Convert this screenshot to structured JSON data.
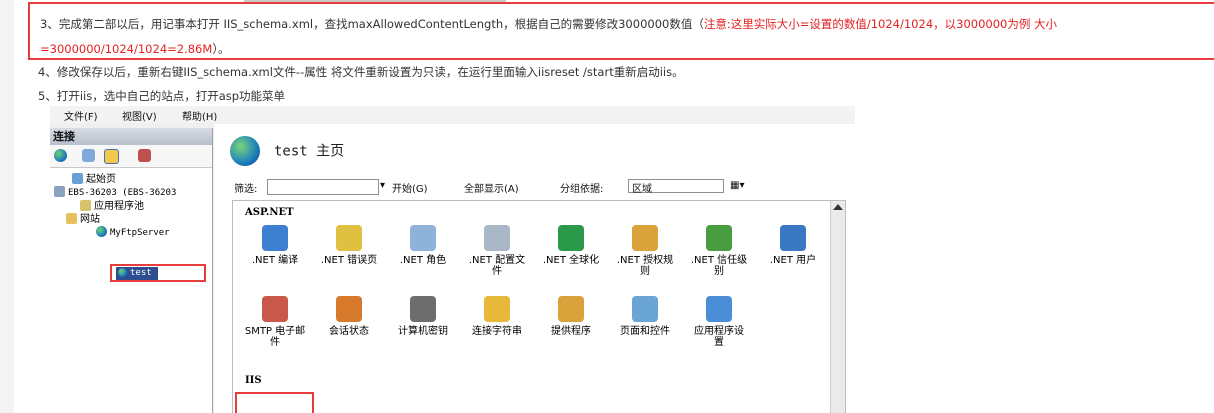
{
  "article": {
    "step3_text": "3、完成第二部以后，用记事本打开 IIS_schema.xml，查找maxAllowedContentLength，根据自己的需要修改3000000数值（",
    "step3_note": "注意:这里实际大小=设置的数值/1024/1024，以3000000为例 大小=3000000/1024/1024=2.86M",
    "step3_end": "）。",
    "step4": "4、修改保存以后，重新右键IIS_schema.xml文件--属性 将文件重新设置为只读，在运行里面输入iisreset /start重新启动iis。",
    "step5": "5、打开iis，选中自己的站点，打开asp功能菜单"
  },
  "iis": {
    "menu": {
      "file": "文件(F)",
      "view": "视图(V)",
      "help": "帮助(H)"
    },
    "connections_title": "连接",
    "tree": {
      "start_page": "起始页",
      "server": "EBS-36203 (EBS-36203",
      "app_pools": "应用程序池",
      "sites": "网站",
      "ftp": "MyFtpServer",
      "test": "test"
    },
    "home_title": "test 主页",
    "filter": {
      "label": "筛选:",
      "start": "开始(G)",
      "show_all": "全部显示(A)",
      "group_by": "分组依据:",
      "group_value": "区域"
    },
    "sections": {
      "aspnet": "ASP.NET",
      "iis": "IIS"
    },
    "aspnet_features": [
      [
        ".NET 编译"
      ],
      [
        ".NET 错误页"
      ],
      [
        ".NET 角色"
      ],
      [
        ".NET 配置文",
        "件"
      ],
      [
        ".NET 全球化"
      ],
      [
        ".NET 授权规",
        "则"
      ],
      [
        ".NET 信任级",
        "别"
      ],
      [
        ".NET 用户"
      ]
    ],
    "aspnet_features_row2": [
      [
        "SMTP 电子邮",
        "件"
      ],
      [
        "会话状态"
      ],
      [
        "计算机密钥"
      ],
      [
        "连接字符串"
      ],
      [
        "提供程序"
      ],
      [
        "页面和控件"
      ],
      [
        "应用程序设",
        "置"
      ]
    ],
    "colors": {
      "accent_red": "#e53c3c",
      "selection": "#2c4d8f"
    }
  }
}
